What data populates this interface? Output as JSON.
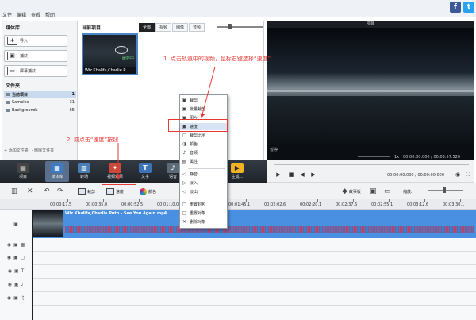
{
  "menu": [
    "文件",
    "编辑",
    "查看",
    "帮助"
  ],
  "social": {
    "fb": "f",
    "tw": "t"
  },
  "media_library": {
    "title": "媒体库",
    "import": "导入",
    "capture": "捕获",
    "screen_capture": "屏幕捕获",
    "folders_title": "文件夹",
    "folders": [
      {
        "name": "当前项目",
        "count": "1"
      },
      {
        "name": "Samples",
        "count": "31"
      },
      {
        "name": "Backgrounds",
        "count": "65"
      }
    ],
    "add_folder": "+ 添加文件夹",
    "delete_folder": "- 删除文件夹"
  },
  "project": {
    "title": "当前项目",
    "tabs": [
      "全部",
      "视频",
      "图像",
      "音频"
    ],
    "clip_name": "Wiz Khalifa,Charlie P",
    "clip_tag": "缓存中"
  },
  "preview": {
    "title": "项目",
    "state": "暂停",
    "speed": "1x",
    "timecode": "00:00:00.000 / 00:03:57.520"
  },
  "transport": {
    "timecode": "00:00:00.000 / 00:00:00.000"
  },
  "toolbar": [
    "项目",
    "媒体库",
    "转场",
    "视频效果",
    "文字",
    "语音",
    "",
    "",
    "",
    "生成..."
  ],
  "edit": {
    "crop": "裁剪",
    "speed": "速度",
    "color": "颜色",
    "storyboard": "故事板",
    "zoom": "缩放:"
  },
  "ruler": [
    "00:00:17.5",
    "00:00:35.0",
    "00:00:52.5",
    "00:01:10.0",
    "00:01:27.6",
    "00:01:45.1",
    "00:02:02.6",
    "00:02:20.1",
    "00:02:37.6",
    "00:02:55.1",
    "00:03:12.6",
    "00:03:30.1"
  ],
  "video_track": {
    "name": "Wiz Khalifa,Charlie Puth - See You Again.mp4"
  },
  "context_menu": [
    "裁剪",
    "批量裁剪",
    "图片",
    "速度",
    "裁剪比例",
    "颜色",
    "音频",
    "属性",
    "静音",
    "淡入",
    "淡出",
    "重置封包",
    "重置对象",
    "删除对象"
  ],
  "notes": {
    "n1": "1. 点击轨道中的视频，鼠标右键选择“速度”",
    "n2": "2. 或点击“速度”按钮"
  }
}
